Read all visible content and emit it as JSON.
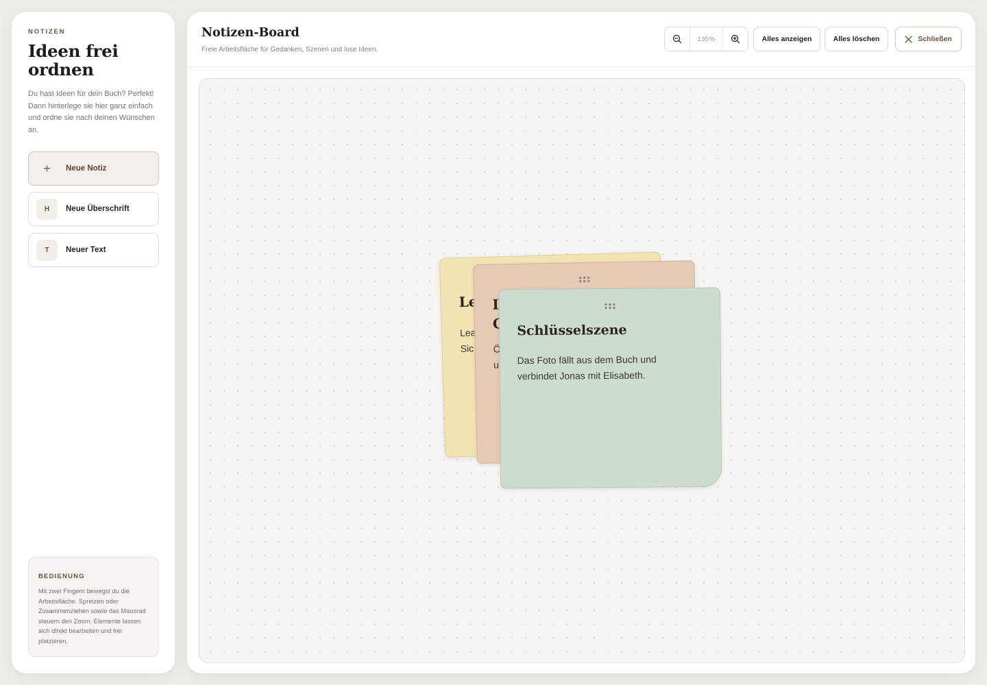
{
  "sidebar": {
    "eyebrow": "NOTIZEN",
    "title": "Ideen frei ordnen",
    "description": "Du hast Ideen für dein Buch? Perfekt! Dann hinterlege sie hier ganz einfach und ordne sie nach deinen Wünschen an.",
    "tools": [
      {
        "icon": "plus-icon",
        "glyph": "+",
        "label": "Neue Notiz",
        "active": true
      },
      {
        "icon": "heading-icon",
        "glyph": "H",
        "label": "Neue Überschrift",
        "active": false
      },
      {
        "icon": "text-icon",
        "glyph": "T",
        "label": "Neuer Text",
        "active": false
      }
    ],
    "help": {
      "title": "BEDIENUNG",
      "text": "Mit zwei Fingern bewegst du die Arbeitsfläche. Spreizen oder Zusammenziehen sowie das Mausrad steuern den Zoom. Elemente lassen sich direkt bearbeiten und frei platzieren."
    }
  },
  "header": {
    "title": "Notizen-Board",
    "subtitle": "Freie Arbeitsfläche für Gedanken, Szenen und lose Ideen.",
    "zoom_level": "135%",
    "show_all_label": "Alles anzeigen",
    "delete_all_label": "Alles löschen",
    "close_label": "Schließen"
  },
  "notes": [
    {
      "color": "#f2e3b4",
      "title": "Le",
      "text_lines": [
        "Lea",
        "Sic"
      ]
    },
    {
      "color": "#e5cab6",
      "title_lines": [
        "I",
        "C"
      ],
      "text_lines": [
        "Ö",
        "u"
      ]
    },
    {
      "color": "#cedccf",
      "title": "Schlüsselszene",
      "text": "Das Foto fällt aus dem Buch und verbindet Jonas mit Elisabeth."
    }
  ],
  "colors": {
    "accent": "#6e4f3e",
    "canvas": "#f6f5f3",
    "note_yellow": "#f2e3b4",
    "note_peach": "#e5cab6",
    "note_green": "#cedccf"
  }
}
